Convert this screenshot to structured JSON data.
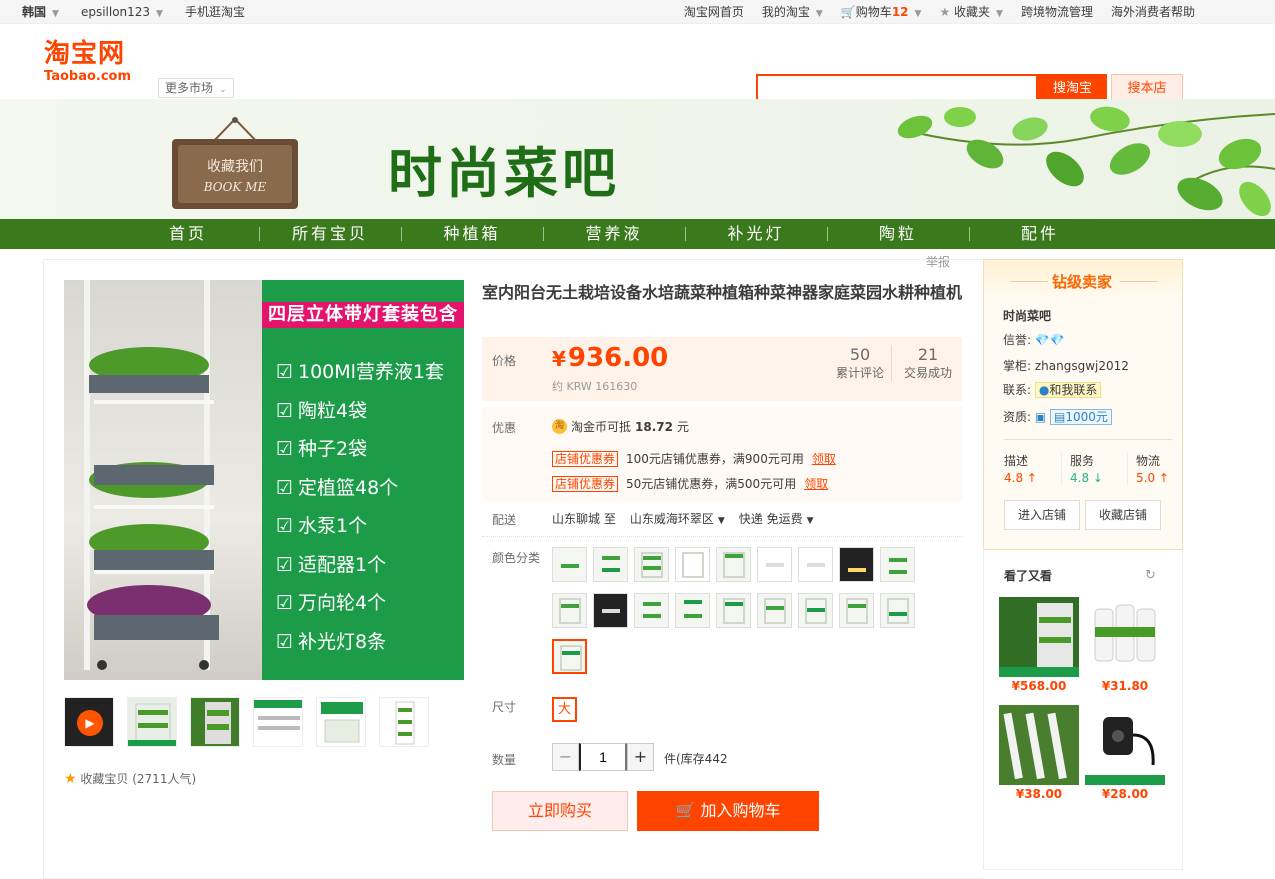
{
  "topbar": {
    "region": "韩国",
    "username": "epsillon123",
    "mobile": "手机逛淘宝",
    "home": "淘宝网首页",
    "my_taobao": "我的淘宝",
    "cart_label": "购物车",
    "cart_count": "12",
    "favorites": "收藏夹",
    "logistics": "跨境物流管理",
    "help": "海外消费者帮助"
  },
  "header": {
    "logo_cn": "淘宝网",
    "logo_en": "Taobao.com",
    "more_market": "更多市场",
    "search_value": "",
    "search_btn": "搜淘宝",
    "shop_search_btn": "搜本店"
  },
  "banner": {
    "board_line1": "收藏我们",
    "board_line2": "BOOK ME",
    "shop_name": "时尚菜吧"
  },
  "nav": [
    "首页",
    "所有宝贝",
    "种植箱",
    "营养液",
    "补光灯",
    "陶粒",
    "配件"
  ],
  "report": "举报",
  "gallery": {
    "promo_header": "四层立体带灯套装包含",
    "promo_items": [
      "100Ml营养液1套",
      "陶粒4袋",
      "种子2袋",
      "定植篮48个",
      "水泵1个",
      "适配器1个",
      "万向轮4个",
      "补光灯8条"
    ],
    "thumb_captions": [
      "",
      "四层立体带灯套装",
      "",
      "单独全光谱补光灯",
      "种植箱补光灯系统套装",
      ""
    ],
    "favorite_label": "收藏宝贝",
    "favorite_count": "(2711人气)"
  },
  "product": {
    "title": "室内阳台无土栽培设备水培蔬菜种植箱种菜神器家庭菜园水耕种植机",
    "price_label": "价格",
    "currency": "¥",
    "price": "936.00",
    "krw": "约 KRW 161630",
    "reviews_count": "50",
    "reviews_label": "累计评论",
    "sales_count": "21",
    "sales_label": "交易成功",
    "promo_label": "优惠",
    "coin_icon": "淘",
    "coin_text_prefix": "淘金币可抵",
    "coin_amount": "18.72",
    "coin_text_suffix": "元",
    "coupons": [
      {
        "tag": "店铺优惠券",
        "text": "100元店铺优惠券，满900元可用",
        "action": "领取"
      },
      {
        "tag": "店铺优惠券",
        "text": "50元店铺优惠券，满500元可用",
        "action": "领取"
      }
    ],
    "delivery_label": "配送",
    "from": "山东聊城 至",
    "to": "山东威海环翠区",
    "shipping": "快递 免运费",
    "color_label": "颜色分类",
    "size_label": "尺寸",
    "size_value": "大",
    "qty_label": "数量",
    "qty_value": "1",
    "stock_text": "件(库存442",
    "buy_now": "立即购买",
    "add_cart": "加入购物车"
  },
  "seller": {
    "badge": "钻级卖家",
    "shop_name": "时尚菜吧",
    "credit_label": "信誉:",
    "keeper_label": "掌柜:",
    "keeper": "zhangsgwj2012",
    "contact_label": "联系:",
    "contact_btn": "和我联系",
    "qual_label": "资质:",
    "deposit": "1000元",
    "scores": [
      {
        "label": "描述",
        "value": "4.8"
      },
      {
        "label": "服务",
        "value": "4.8"
      },
      {
        "label": "物流",
        "value": "5.0"
      }
    ],
    "enter_shop": "进入店铺",
    "fav_shop": "收藏店铺"
  },
  "seen": {
    "title": "看了又看",
    "items": [
      {
        "price": "¥568.00"
      },
      {
        "price": "¥31.80"
      },
      {
        "price": "¥38.00"
      },
      {
        "price": "¥28.00"
      }
    ]
  }
}
